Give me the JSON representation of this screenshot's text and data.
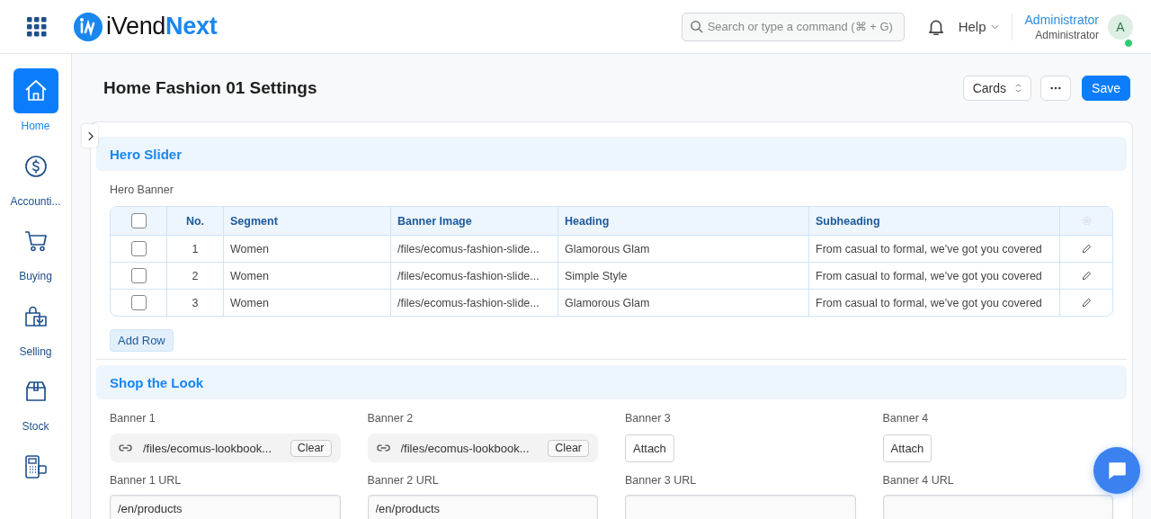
{
  "app": {
    "brand_main": "iVend",
    "brand_accent": "Next"
  },
  "search": {
    "placeholder": "Search or type a command (⌘ + G)"
  },
  "help": {
    "label": "Help"
  },
  "user": {
    "name": "Administrator",
    "role": "Administrator",
    "initial": "A",
    "online": true
  },
  "sidebar": {
    "items": [
      {
        "label": "Home",
        "selected": true
      },
      {
        "label": "Accounti...",
        "selected": false
      },
      {
        "label": "Buying",
        "selected": false
      },
      {
        "label": "Selling",
        "selected": false
      },
      {
        "label": "Stock",
        "selected": false
      },
      {
        "selected": false
      }
    ]
  },
  "page": {
    "title": "Home Fashion 01 Settings",
    "view_select": "Cards",
    "save": "Save"
  },
  "sections": [
    {
      "kind": "table",
      "title": "Hero Slider",
      "label": "Hero Banner",
      "select_all": false,
      "columns": [
        "No.",
        "Segment",
        "Banner Image",
        "Heading",
        "Subheading"
      ],
      "rows": [
        {
          "checked": false,
          "cells": [
            "1",
            "Women",
            "/files/ecomus-fashion-slide...",
            "Glamorous Glam",
            "From casual to formal, we've got you covered"
          ]
        },
        {
          "checked": false,
          "cells": [
            "2",
            "Women",
            "/files/ecomus-fashion-slide...",
            "Simple Style",
            "From casual to formal, we've got you covered"
          ]
        },
        {
          "checked": false,
          "cells": [
            "3",
            "Women",
            "/files/ecomus-fashion-slide...",
            "Glamorous Glam",
            "From casual to formal, we've got you covered"
          ]
        }
      ],
      "add_row": "Add Row"
    },
    {
      "kind": "fields",
      "title": "Shop the Look",
      "banners": [
        {
          "label": "Banner 1",
          "file": "/files/ecomus-lookbook...",
          "action": "Clear",
          "url_label": "Banner 1 URL",
          "url": "/en/products"
        },
        {
          "label": "Banner 2",
          "file": "/files/ecomus-lookbook...",
          "action": "Clear",
          "url_label": "Banner 2 URL",
          "url": "/en/products"
        },
        {
          "label": "Banner 3",
          "action": "Attach",
          "url_label": "Banner 3 URL"
        },
        {
          "label": "Banner 4",
          "action": "Attach",
          "url_label": "Banner 4 URL"
        }
      ]
    }
  ]
}
